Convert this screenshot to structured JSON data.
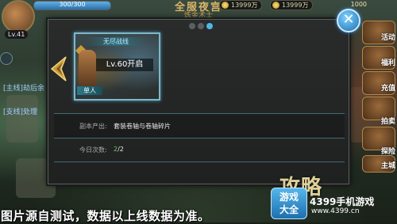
{
  "hud": {
    "hp_text": "300/300",
    "level": "Lv.41",
    "title": "全服夜宫",
    "subtitle": "炼金术士",
    "coins1": "13999万",
    "coins2": "13999万",
    "right_num": "1000"
  },
  "left_panel": {
    "quest_main": "[主线]劫后余",
    "quest_side": "[支线]处理"
  },
  "right_panel": {
    "items": [
      "活动",
      "福利",
      "充值",
      "拍卖",
      "探险",
      "主城"
    ]
  },
  "modal": {
    "pager": {
      "count": 3,
      "active": 2
    },
    "close_symbol": "✕",
    "card": {
      "ribbon": "无尽战线",
      "level_text": "Lv.60开启",
      "mode": "单人"
    },
    "drop_label": "副本产出:",
    "drop_value": "套装卷轴与卷轴碎片",
    "count_label": "今日次数:",
    "count_current": "2",
    "count_total": "/2"
  },
  "footer": {
    "disclaimer": "图片源自测试，数据以上线数据为准。",
    "banner_word": "攻略",
    "logo_top": "游戏",
    "logo_bottom": "大全",
    "brand": "4399手机游戏",
    "url": "www.4399.cn"
  },
  "colors": {
    "accent": "#4fb6e6",
    "count_green": "#6fd04e"
  }
}
